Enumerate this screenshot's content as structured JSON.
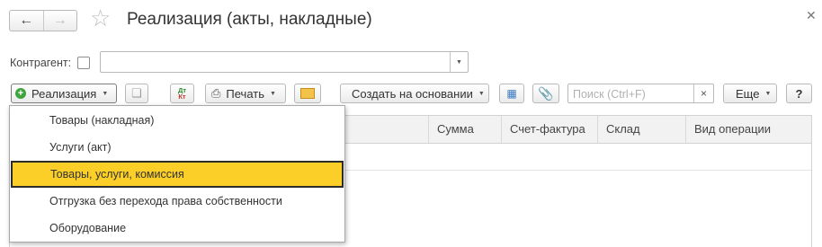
{
  "window": {
    "title": "Реализация (акты, накладные)"
  },
  "filters": {
    "contractor_label": "Контрагент:"
  },
  "toolbar": {
    "realization_label": "Реализация",
    "print_label": "Печать",
    "dtkt_top": "Дт",
    "dtkt_bottom": "Кт",
    "create_based_label": "Создать на основании",
    "search_placeholder": "Поиск (Ctrl+F)",
    "more_label": "Еще",
    "help_label": "?"
  },
  "table": {
    "columns": [
      "Сумма",
      "Счет-фактура",
      "Склад",
      "Вид операции"
    ]
  },
  "menu": {
    "items": [
      {
        "label": "Товары (накладная)"
      },
      {
        "label": "Услуги (акт)"
      },
      {
        "label": "Товары, услуги, комиссия",
        "active": true
      },
      {
        "label": "Отгрузка без перехода права собственности"
      },
      {
        "label": "Оборудование"
      }
    ]
  },
  "colors": {
    "highlight": "#fbcf27",
    "add_icon": "#3fa33f"
  },
  "icons": [
    "back-arrow-icon",
    "forward-arrow-icon",
    "star-icon",
    "close-icon",
    "plus-circle-icon",
    "copy-icon",
    "printer-icon",
    "envelope-icon",
    "structure-icon",
    "paperclip-icon",
    "clear-icon"
  ]
}
